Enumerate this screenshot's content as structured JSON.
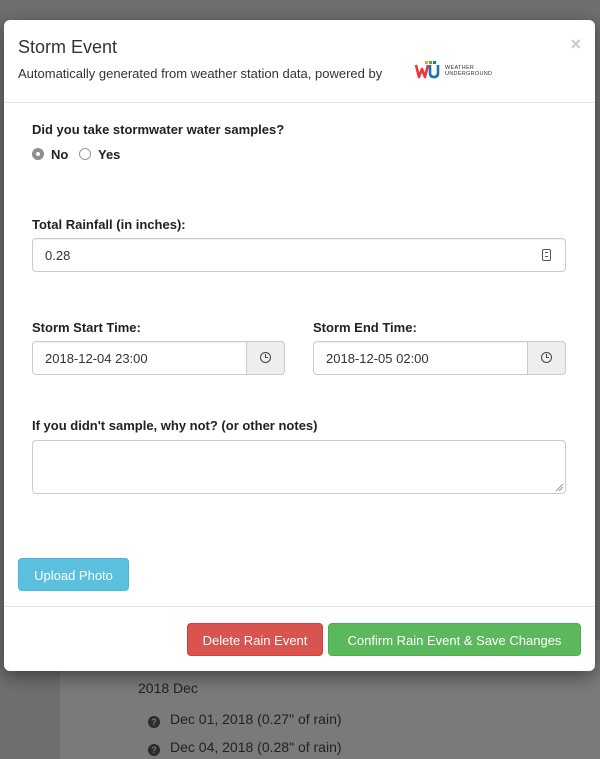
{
  "background": {
    "month": "2018 Dec",
    "entries": [
      "Dec 01, 2018 (0.27\" of rain)",
      "Dec 04, 2018 (0.28\" of rain)"
    ]
  },
  "modal": {
    "title": "Storm Event",
    "subtitle": "Automatically generated from weather station data, powered by",
    "logo_text_1": "WEATHER",
    "logo_text_2": "UNDERGROUND",
    "close": "×"
  },
  "samples": {
    "question": "Did you take stormwater water samples?",
    "options": [
      "No",
      "Yes"
    ],
    "selected": "No"
  },
  "rainfall": {
    "label": "Total Rainfall (in inches):",
    "value": "0.28"
  },
  "start": {
    "label": "Storm Start Time:",
    "value": "2018-12-04 23:00"
  },
  "end": {
    "label": "Storm End Time:",
    "value": "2018-12-05 02:00"
  },
  "notes": {
    "label": "If you didn't sample, why not? (or other notes)",
    "value": ""
  },
  "buttons": {
    "upload": "Upload Photo",
    "delete": "Delete Rain Event",
    "confirm": "Confirm Rain Event & Save Changes"
  },
  "colors": {
    "upload": "#5bc0de",
    "delete": "#d9534f",
    "confirm": "#5cb85c",
    "overlay": "#6f6f6f"
  }
}
